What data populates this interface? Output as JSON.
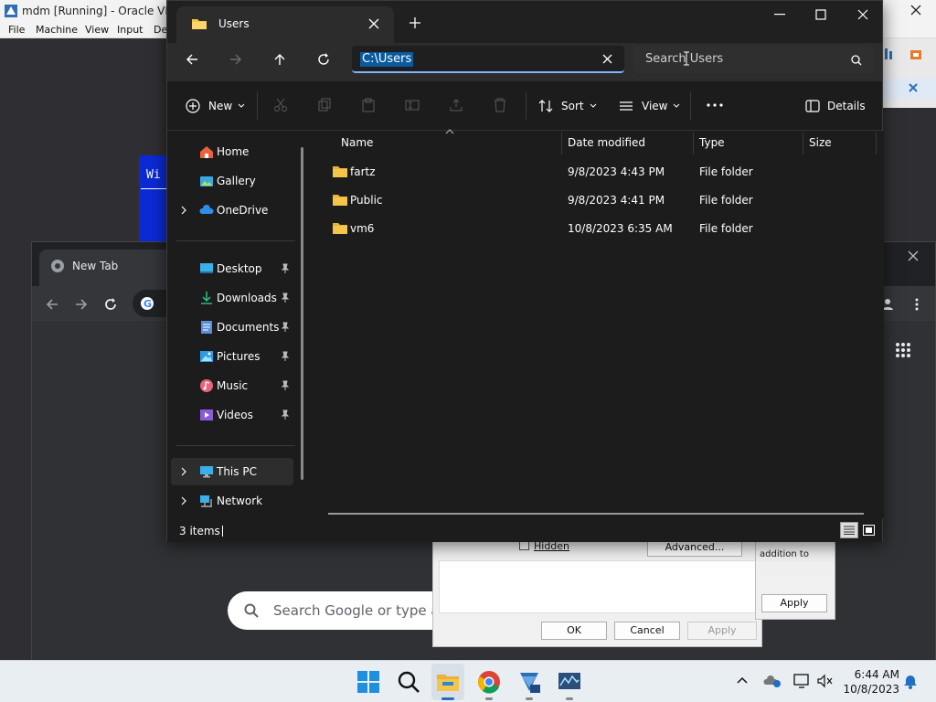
{
  "host": {
    "title": "mdm [Running] - Oracle VM V",
    "menu": [
      "File",
      "Machine",
      "View",
      "Input",
      "De"
    ]
  },
  "explorer": {
    "tab_title": "Users",
    "address": "C:\\Users",
    "search_placeholder": "Search Users",
    "toolbar": {
      "new_label": "New",
      "sort_label": "Sort",
      "view_label": "View",
      "details_label": "Details"
    },
    "nav": {
      "home": "Home",
      "gallery": "Gallery",
      "onedrive": "OneDrive",
      "desktop": "Desktop",
      "downloads": "Downloads",
      "documents": "Documents",
      "pictures": "Pictures",
      "music": "Music",
      "videos": "Videos",
      "this_pc": "This PC",
      "network": "Network"
    },
    "columns": {
      "name": "Name",
      "date": "Date modified",
      "type": "Type",
      "size": "Size"
    },
    "rows": [
      {
        "name": "fartz",
        "date": "9/8/2023 4:43 PM",
        "type": "File folder"
      },
      {
        "name": "Public",
        "date": "9/8/2023 4:41 PM",
        "type": "File folder"
      },
      {
        "name": "vm6",
        "date": "10/8/2023 6:35 AM",
        "type": "File folder"
      }
    ],
    "status": "3 items"
  },
  "chrome": {
    "tab_label": "New Tab",
    "search_placeholder": "Search Google or type a"
  },
  "dialog": {
    "hidden_label": "Hidden",
    "advanced_label": "Advanced...",
    "ok_label": "OK",
    "cancel_label": "Cancel",
    "apply_label": "Apply",
    "apply2_label": "Apply",
    "side_text": "addition to"
  },
  "vm_text": "Wi",
  "taskbar": {
    "time": "6:44 AM",
    "date": "10/8/2023"
  },
  "colors": {
    "accent": "#7fb2ff",
    "folder": "#f4c54b",
    "selection": "#0a5aa0"
  }
}
